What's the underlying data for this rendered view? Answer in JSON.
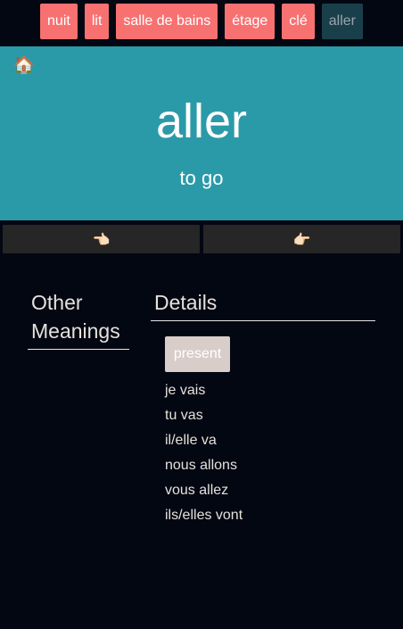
{
  "topnav": {
    "items": [
      {
        "label": "nuit",
        "active": false
      },
      {
        "label": "lit",
        "active": false
      },
      {
        "label": "salle de bains",
        "active": false
      },
      {
        "label": "étage",
        "active": false
      },
      {
        "label": "clé",
        "active": false
      },
      {
        "label": "aller",
        "active": true
      }
    ]
  },
  "hero": {
    "home_icon": "🏠",
    "word": "aller",
    "translation": "to go"
  },
  "nav": {
    "prev_icon": "👈🏻",
    "next_icon": "👉🏻"
  },
  "sections": {
    "other_meanings_title": "Other Meanings",
    "details_title": "Details"
  },
  "details": {
    "tense_label": "present",
    "conjugations": [
      "je vais",
      "tu vas",
      "il/elle va",
      "nous allons",
      "vous allez",
      "ils/elles vont"
    ]
  },
  "colors": {
    "background": "#030712",
    "hero": "#2b9aa8",
    "tag": "#f87171",
    "tag_active": "#19404a",
    "nav_button": "#262626",
    "tense_button": "#d9cdc9"
  }
}
